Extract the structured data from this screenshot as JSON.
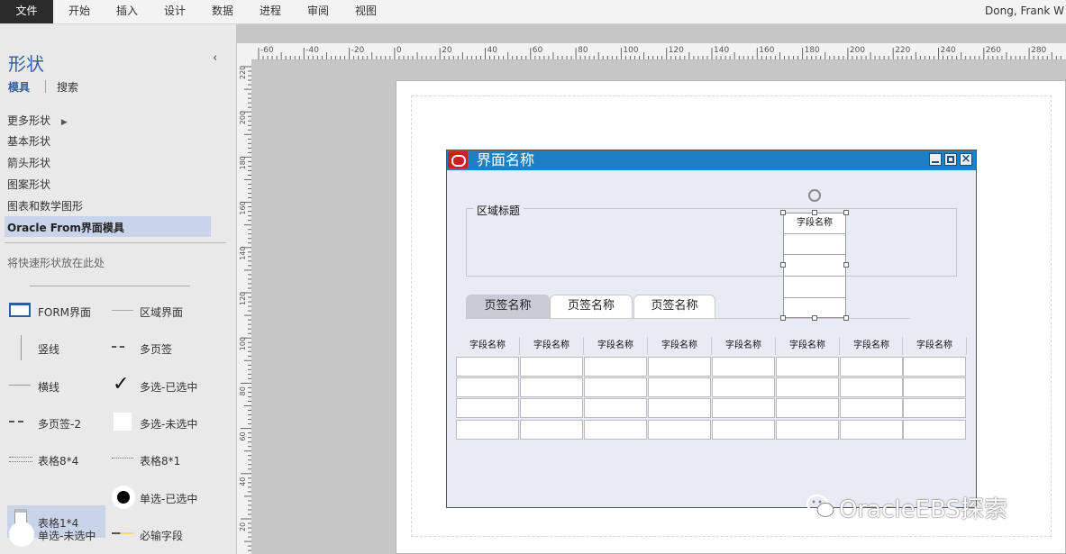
{
  "menu": {
    "file": "文件",
    "items": [
      "开始",
      "插入",
      "设计",
      "数据",
      "进程",
      "审阅",
      "视图"
    ],
    "user": "Dong, Frank W"
  },
  "shapes_panel": {
    "title": "形状",
    "collapse_icon": "‹",
    "tabs": {
      "stencil": "模具",
      "search": "搜索"
    },
    "categories": [
      "更多形状",
      "基本形状",
      "箭头形状",
      "图案形状",
      "图表和数学图形",
      "Oracle From界面模具"
    ],
    "more_arrow": "▶",
    "quick_hint": "将快速形状放在此处",
    "stencils": [
      "FORM界面",
      "区域界面",
      "竖线",
      "多页签",
      "横线",
      "多选-已选中",
      "多页签-2",
      "多选-未选中",
      "表格8*4",
      "表格8*1",
      "表格1*4",
      "单选-已选中",
      "单选-未选中",
      "必输字段"
    ]
  },
  "ruler": {
    "top": [
      "-60",
      "-40",
      "-20",
      "0",
      "20",
      "40",
      "60",
      "80",
      "100",
      "120",
      "140",
      "160",
      "180",
      "200",
      "220",
      "240",
      "260",
      "280"
    ],
    "left": [
      "220",
      "200",
      "180",
      "160",
      "140",
      "120",
      "100",
      "80",
      "60",
      "40",
      "20"
    ]
  },
  "form": {
    "title": "界面名称",
    "window_buttons": [
      "▁",
      "□",
      "×"
    ],
    "region_title": "区域标题",
    "tabs": [
      "页签名称",
      "页签名称",
      "页签名称"
    ],
    "field_header": "字段名称",
    "table_headers": [
      "字段名称",
      "字段名称",
      "字段名称",
      "字段名称",
      "字段名称",
      "字段名称",
      "字段名称",
      "字段名称"
    ]
  },
  "watermark": "OracleEBS探索",
  "colors": {
    "accent": "#2e5fa8",
    "titlebar": "#1d80c3",
    "selected_category": "#c9d3ea",
    "oracle_red": "#cc1f1f"
  }
}
